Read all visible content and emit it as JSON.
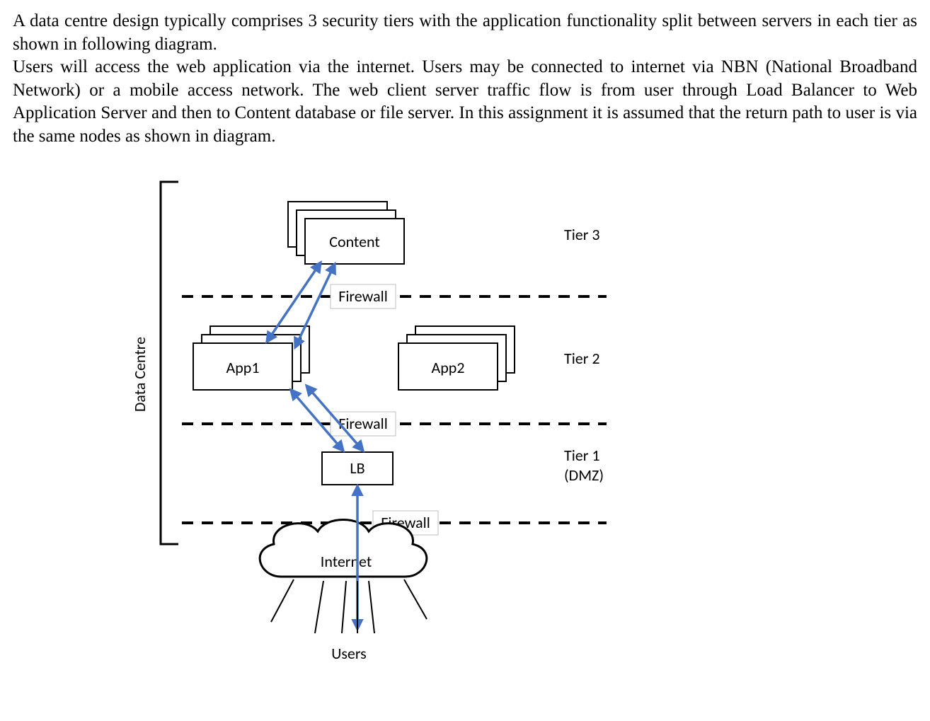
{
  "text": {
    "para1": "A data centre design typically comprises 3 security tiers with the application functionality split between servers in each tier as shown in following diagram.",
    "para2": "Users will access the web application via the internet. Users may be connected to internet via NBN (National Broadband Network) or a mobile access network. The web client server traffic flow is from user through Load Balancer to Web Application Server and then to Content database or file server. In this assignment it is assumed that the return path to user is via the same nodes as shown in diagram."
  },
  "diagram": {
    "bracket_label": "Data Centre",
    "tier3_label": "Tier 3",
    "tier2_label": "Tier 2",
    "tier1_label_line1": "Tier 1",
    "tier1_label_line2": "(DMZ)",
    "firewall_label": "Firewall",
    "content_label": "Content",
    "app1_label": "App1",
    "app2_label": "App2",
    "lb_label": "LB",
    "internet_label": "Internet",
    "users_label": "Users"
  },
  "nodes": [
    {
      "id": "content",
      "tier": 3,
      "label": "Content"
    },
    {
      "id": "app1",
      "tier": 2,
      "label": "App1"
    },
    {
      "id": "app2",
      "tier": 2,
      "label": "App2"
    },
    {
      "id": "lb",
      "tier": 1,
      "label": "LB"
    },
    {
      "id": "internet",
      "tier": 0,
      "label": "Internet"
    },
    {
      "id": "users",
      "tier": 0,
      "label": "Users"
    }
  ],
  "firewalls": [
    {
      "between": [
        "tier3",
        "tier2"
      ]
    },
    {
      "between": [
        "tier2",
        "tier1"
      ]
    },
    {
      "between": [
        "tier1",
        "internet"
      ]
    }
  ],
  "flows": [
    {
      "from": "users",
      "to": "lb",
      "bidir": true
    },
    {
      "from": "lb",
      "to": "app1",
      "bidir": true
    },
    {
      "from": "lb",
      "to": "app1",
      "bidir": true
    },
    {
      "from": "app1",
      "to": "content",
      "bidir": true
    },
    {
      "from": "app1",
      "to": "content",
      "bidir": true
    }
  ]
}
